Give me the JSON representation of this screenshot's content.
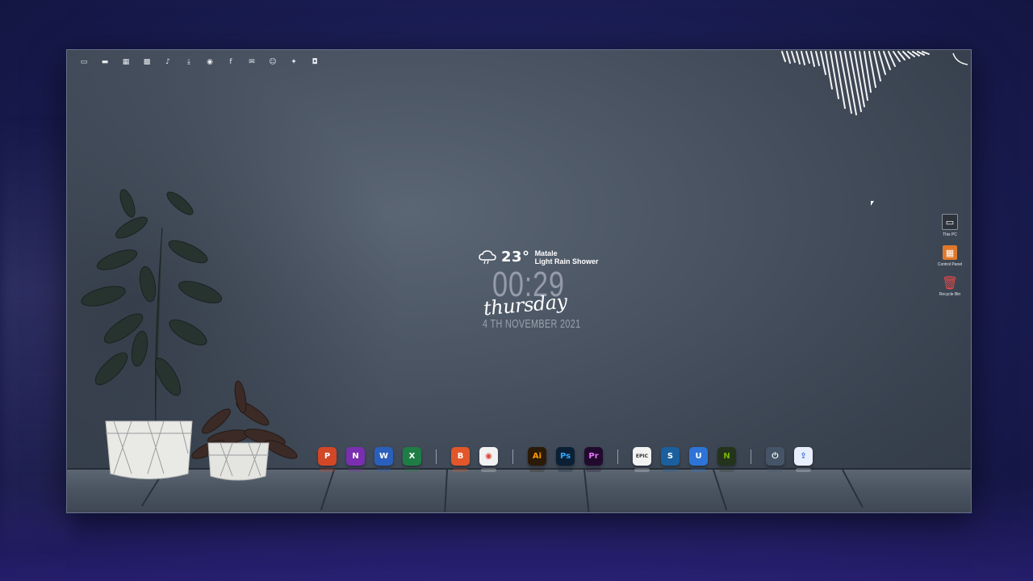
{
  "tray_icons": [
    {
      "name": "monitor-icon",
      "glyph": "▭"
    },
    {
      "name": "folder-icon",
      "glyph": "▬"
    },
    {
      "name": "film-icon",
      "glyph": "▦"
    },
    {
      "name": "images-icon",
      "glyph": "▩"
    },
    {
      "name": "music-icon",
      "glyph": "♪"
    },
    {
      "name": "download-icon",
      "glyph": "⤓"
    },
    {
      "name": "chrome-icon",
      "glyph": "◉"
    },
    {
      "name": "facebook-icon",
      "glyph": "f"
    },
    {
      "name": "mail-icon",
      "glyph": "✉"
    },
    {
      "name": "discord-icon",
      "glyph": "☺"
    },
    {
      "name": "twitter-icon",
      "glyph": "✦"
    },
    {
      "name": "camera-icon",
      "glyph": "◘"
    }
  ],
  "weather": {
    "icon": "rain-cloud-icon",
    "temperature": "23°",
    "location": "Matale",
    "condition": "Light Rain Shower"
  },
  "clock": {
    "time": "00:29",
    "day": "thursday",
    "date": "4 TH NOVEMBER 2021"
  },
  "desktop_icons": [
    {
      "label": "This PC",
      "icon": "monitor-icon",
      "color": "#3a3f48"
    },
    {
      "label": "Control Panel",
      "icon": "control-panel-icon",
      "color": "#e0782c"
    },
    {
      "label": "Recycle Bin",
      "icon": "recycle-bin-icon",
      "color": "#d23a3a"
    }
  ],
  "dock": {
    "groups": [
      [
        {
          "name": "powerpoint",
          "text": "P",
          "color": "#d24726"
        },
        {
          "name": "onenote",
          "text": "N",
          "color": "#7a2fb0"
        },
        {
          "name": "word",
          "text": "W",
          "color": "#2b5fbd"
        },
        {
          "name": "excel",
          "text": "X",
          "color": "#1e7d45"
        }
      ],
      [
        {
          "name": "brave",
          "text": "B",
          "color": "#e2572a"
        },
        {
          "name": "chrome",
          "text": "◉",
          "color": "#f1f1f1"
        }
      ],
      [
        {
          "name": "illustrator",
          "text": "Ai",
          "color": "#2b1a08"
        },
        {
          "name": "photoshop",
          "text": "Ps",
          "color": "#0c2035"
        },
        {
          "name": "premiere",
          "text": "Pr",
          "color": "#220a2e"
        }
      ],
      [
        {
          "name": "epic-games",
          "text": "EPIC",
          "color": "#f2f2f2"
        },
        {
          "name": "steam",
          "text": "S",
          "color": "#1b5f9e"
        },
        {
          "name": "uplay",
          "text": "U",
          "color": "#2d74d6"
        },
        {
          "name": "nvidia",
          "text": "N",
          "color": "#24331c"
        }
      ],
      [
        {
          "name": "power",
          "text": "⏻",
          "color": "#465467"
        },
        {
          "name": "share",
          "text": "⇪",
          "color": "#e9eefc"
        }
      ]
    ]
  },
  "colors": {
    "accent": "#ffffff",
    "wall": "#46505e",
    "floor": "#4b5562"
  }
}
